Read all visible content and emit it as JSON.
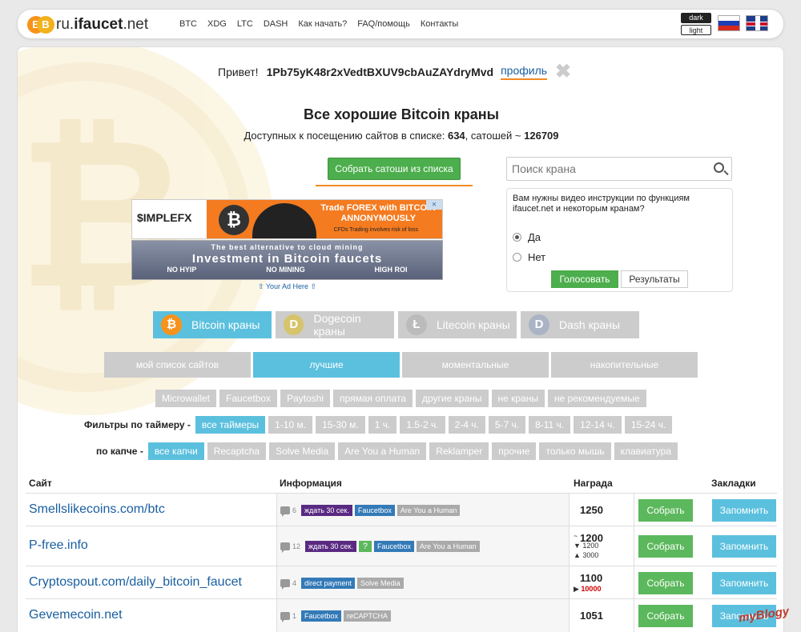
{
  "header": {
    "logo_coin1": "B",
    "logo_coin2": "B",
    "logo_prefix": "ru.",
    "logo_main": "ifaucet",
    "logo_suffix": ".net",
    "nav": [
      "BTC",
      "XDG",
      "LTC",
      "DASH",
      "Как начать?",
      "FAQ/помощь",
      "Контакты"
    ],
    "theme_dark": "dark",
    "theme_light": "light",
    "flags": [
      "ru-flag",
      "en-flag"
    ]
  },
  "greeting": {
    "hello": "Привет!",
    "address": "1Pb75yK48r2xVedtBXUV9cbAuZAYdryMvd",
    "profile": "профиль",
    "close": "✖"
  },
  "title": "Все хорошие Bitcoin краны",
  "stats": {
    "prefix": "Доступных к посещению сайтов в списке:",
    "sites": "634",
    "middle": ", сатошей ~",
    "satoshi": "126709"
  },
  "collect_button": "Собрать сатоши из списка",
  "search": {
    "placeholder": "Поиск крана"
  },
  "poll": {
    "question": "Вам нужны видео инструкции по функциям ifaucet.net и некоторым кранам?",
    "options": [
      "Да",
      "Нет"
    ],
    "selected": "Да",
    "vote": "Голосовать",
    "results": "Результаты"
  },
  "ads": {
    "banner1": {
      "brand": "$IMPLEFX",
      "coin": "₿",
      "headline1": "Trade FOREX with BITCOIN",
      "headline2": "ANNONYMOUSLY",
      "disclaimer": "CFDs Trading involves risk of loss",
      "close": "⨯"
    },
    "banner2": {
      "line1": "The best alternative to cloud mining",
      "line2": "Investment in Bitcoin faucets",
      "tags": [
        "NO HYIP",
        "NO MINING",
        "HIGH ROI"
      ]
    },
    "your_ad": "⇧ Your Ad Here ⇧"
  },
  "coin_tabs": [
    {
      "label": "Bitcoin краны",
      "icon": "₿",
      "color": "#f7931a",
      "active": true
    },
    {
      "label": "Dogecoin краны",
      "icon": "D",
      "color": "#d6c46c",
      "active": false
    },
    {
      "label": "Litecoin краны",
      "icon": "Ł",
      "color": "#bbbbbb",
      "active": false
    },
    {
      "label": "Dash краны",
      "icon": "D",
      "color": "#aab4c4",
      "active": false
    }
  ],
  "category_tabs": [
    "мой список сайтов",
    "лучшие",
    "моментальные",
    "накопительные"
  ],
  "category_active": "лучшие",
  "type_tags": [
    "Microwallet",
    "Faucetbox",
    "Paytoshi",
    "прямая оплата",
    "другие краны",
    "не краны",
    "не рекомендуемые"
  ],
  "timer_filter": {
    "label": "Фильтры по таймеру -",
    "options": [
      "все таймеры",
      "1-10 м.",
      "15-30 м.",
      "1 ч.",
      "1.5-2 ч.",
      "2-4 ч.",
      "5-7 ч.",
      "8-11 ч.",
      "12-14 ч.",
      "15-24 ч."
    ],
    "active": "все таймеры"
  },
  "captcha_filter": {
    "label": "по капче -",
    "options": [
      "все капчи",
      "Recaptcha",
      "Solve Media",
      "Are You a Human",
      "Reklamper",
      "прочие",
      "только мышь",
      "клавиатура"
    ],
    "active": "все капчи"
  },
  "table": {
    "headers": [
      "Сайт",
      "Информация",
      "Награда",
      "Закладки"
    ],
    "rows": [
      {
        "site": "Smellslikecoins.com/btc",
        "comments": "6",
        "labels": [
          {
            "text": "ждать 30 сек.",
            "kind": "purple"
          },
          {
            "text": "Faucetbox",
            "kind": "blue"
          },
          {
            "text": "Are You a Human",
            "kind": "gray"
          }
        ],
        "reward": "1250",
        "collect": "Собрать",
        "bookmark": "Запомнить"
      },
      {
        "site": "P-free.info",
        "comments": "12",
        "labels": [
          {
            "text": "ждать 30 сек.",
            "kind": "purple"
          },
          {
            "text": "?",
            "kind": "green"
          },
          {
            "text": "Faucetbox",
            "kind": "blue"
          },
          {
            "text": "Are You a Human",
            "kind": "gray"
          }
        ],
        "reward": "1200",
        "reward_prefix": "~",
        "reward_min": "1200",
        "reward_max": "3000",
        "collect": "Собрать",
        "bookmark": "Запомнить"
      },
      {
        "site": "Cryptospout.com/daily_bitcoin_faucet",
        "comments": "4",
        "labels": [
          {
            "text": "direct payment",
            "kind": "blue"
          },
          {
            "text": "Solve Media",
            "kind": "gray"
          }
        ],
        "reward": "1100",
        "reward_bonus": "10000",
        "collect": "Собрать",
        "bookmark": "Запомнить"
      },
      {
        "site": "Gevemecoin.net",
        "comments": "1",
        "labels": [
          {
            "text": "Faucetbox",
            "kind": "blue"
          },
          {
            "text": "reCAPTCHA",
            "kind": "gray"
          }
        ],
        "reward": "1051",
        "collect": "Собрать",
        "bookmark": "Запомнить"
      }
    ]
  },
  "watermark": {
    "a": "my",
    "b": "Blogy"
  }
}
